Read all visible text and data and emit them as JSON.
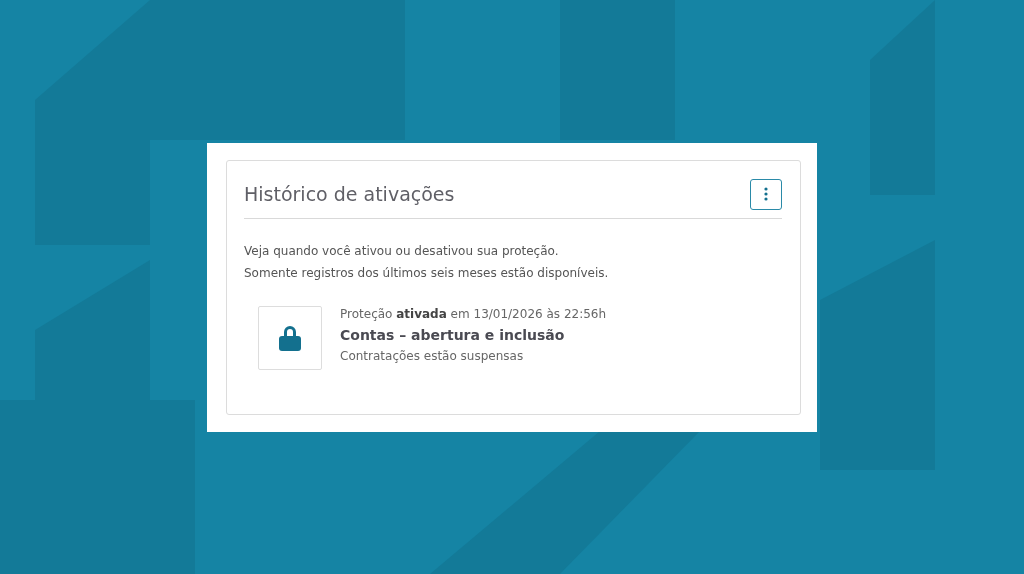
{
  "panel": {
    "title": "Histórico de ativações"
  },
  "description": [
    "Veja quando você ativou ou desativou sua proteção.",
    "Somente registros dos últimos seis meses estão disponíveis."
  ],
  "entries": [
    {
      "kind": "lock",
      "event": "Proteção **ativada** em 13/01/2026 às 22:56h",
      "title": "Contas – abertura e inclusão",
      "detail": "Contratações estão suspensas"
    }
  ]
}
